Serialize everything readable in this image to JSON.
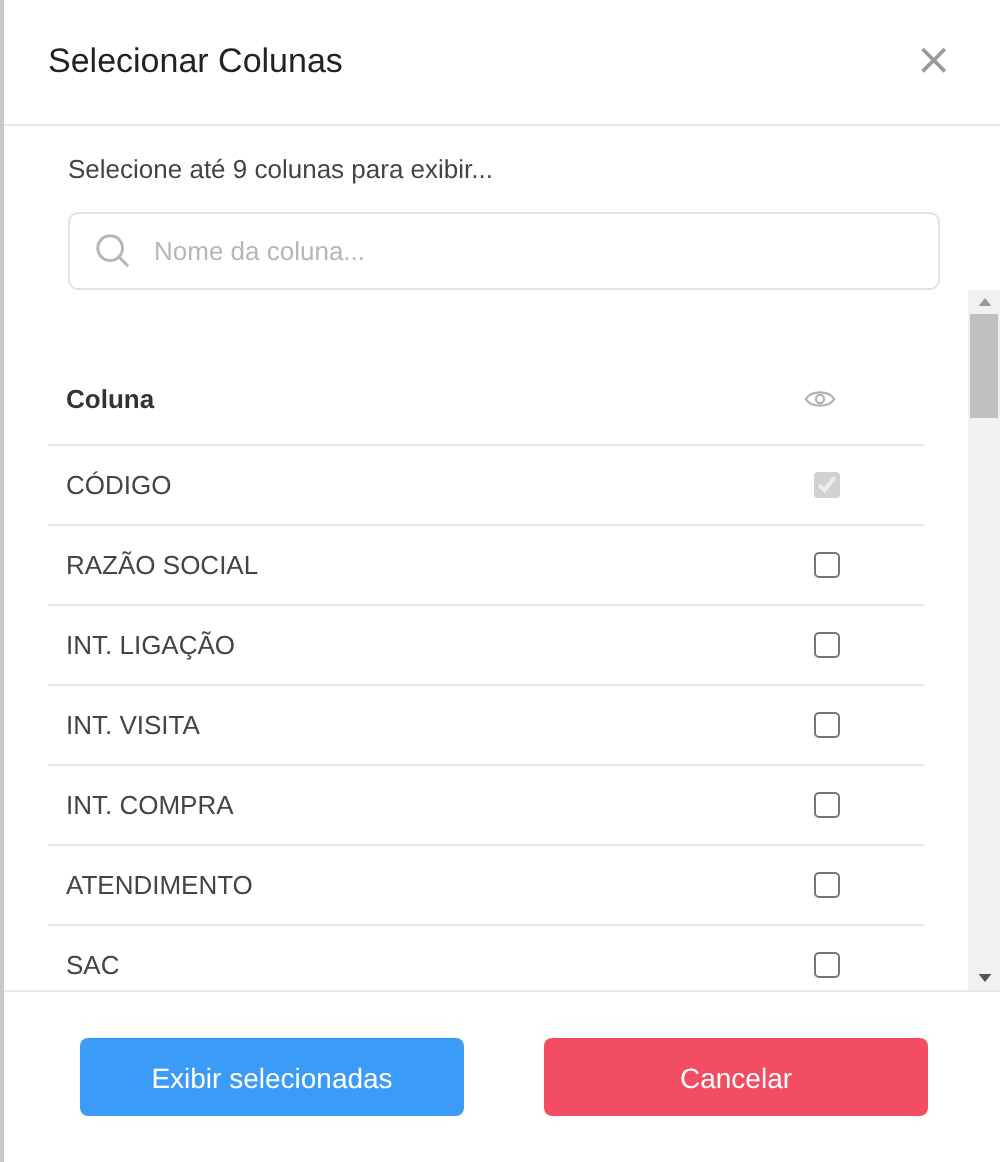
{
  "dialog": {
    "title": "Selecionar Colunas",
    "close": "×"
  },
  "hint": "Selecione até 9 colunas para exibir...",
  "search": {
    "placeholder": "Nome da coluna..."
  },
  "table": {
    "header": "Coluna",
    "rows": [
      {
        "name": "CÓDIGO",
        "checked": true,
        "disabled": true
      },
      {
        "name": "RAZÃO SOCIAL",
        "checked": false,
        "disabled": false
      },
      {
        "name": "INT. LIGAÇÃO",
        "checked": false,
        "disabled": false
      },
      {
        "name": "INT. VISITA",
        "checked": false,
        "disabled": false
      },
      {
        "name": "INT. COMPRA",
        "checked": false,
        "disabled": false
      },
      {
        "name": "ATENDIMENTO",
        "checked": false,
        "disabled": false
      },
      {
        "name": "SAC",
        "checked": false,
        "disabled": false
      }
    ]
  },
  "buttons": [
    {
      "label": "Exibir selecionadas",
      "kind": "primary"
    },
    {
      "label": "Cancelar",
      "kind": "danger"
    }
  ]
}
